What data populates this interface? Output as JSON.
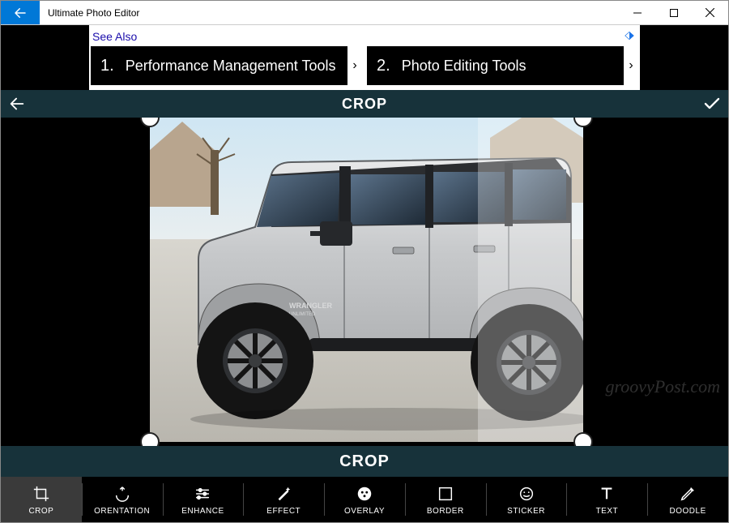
{
  "window": {
    "title": "Ultimate Photo Editor"
  },
  "ad": {
    "header": "See Also",
    "items": [
      {
        "num": "1.",
        "label": "Performance Management Tools"
      },
      {
        "num": "2.",
        "label": "Photo Editing Tools"
      }
    ]
  },
  "mode": {
    "title": "CROP",
    "label_bar": "CROP"
  },
  "tools": [
    {
      "id": "crop",
      "label": "CROP",
      "active": true
    },
    {
      "id": "orientation",
      "label": "ORENTATION",
      "active": false
    },
    {
      "id": "enhance",
      "label": "ENHANCE",
      "active": false
    },
    {
      "id": "effect",
      "label": "EFFECT",
      "active": false
    },
    {
      "id": "overlay",
      "label": "OVERLAY",
      "active": false
    },
    {
      "id": "border",
      "label": "BORDER",
      "active": false
    },
    {
      "id": "sticker",
      "label": "STICKER",
      "active": false
    },
    {
      "id": "text",
      "label": "TEXT",
      "active": false
    },
    {
      "id": "doodle",
      "label": "DOODLE",
      "active": false
    }
  ],
  "watermark": "groovyPost.com"
}
